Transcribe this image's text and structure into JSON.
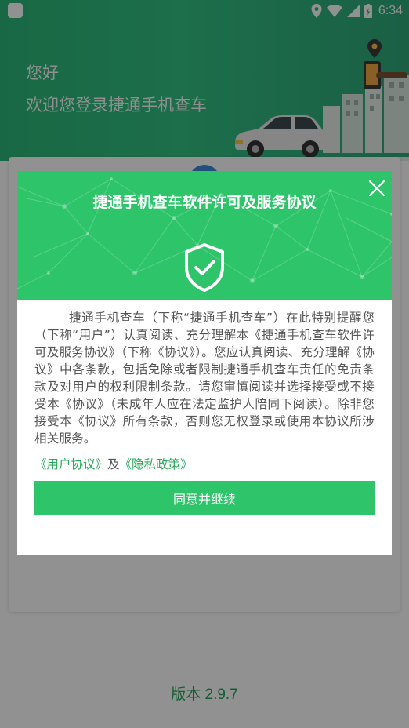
{
  "status_bar": {
    "time": "6:34"
  },
  "header": {
    "greeting": "您好",
    "welcome": "欢迎您登录捷通手机查车"
  },
  "footer": {
    "version": "版本 2.9.7"
  },
  "dialog": {
    "title": "捷通手机查车软件许可及服务协议",
    "body": "捷通手机查车（下称“捷通手机查车”）在此特别提醒您（下称“用户”）认真阅读、充分理解本《捷通手机查车软件许可及服务协议》（下称《协议》）。您应认真阅读、充分理解《协议》中各条款，包括免除或者限制捷通手机查车责任的免责条款及对用户的权利限制条款。请您审慎阅读并选择接受或不接受本《协议》（未成年人应在法定监护人陪同下阅读）。除非您接受本《协议》所有条款，否则您无权登录或使用本协议所涉相关服务。",
    "user_agreement_link": "《用户协议》",
    "and_text": "及",
    "privacy_policy_link": "《隐私政策》",
    "agree_button": "同意并继续"
  },
  "colors": {
    "brand_green": "#2ec46a",
    "link_green": "#2aa85a",
    "version_green": "#22a45b"
  },
  "icons": {
    "close": "close-icon",
    "shield": "shield-check-icon",
    "location": "location-pin-icon",
    "wifi": "wifi-icon",
    "signal": "cell-signal-icon",
    "battery": "battery-icon"
  }
}
